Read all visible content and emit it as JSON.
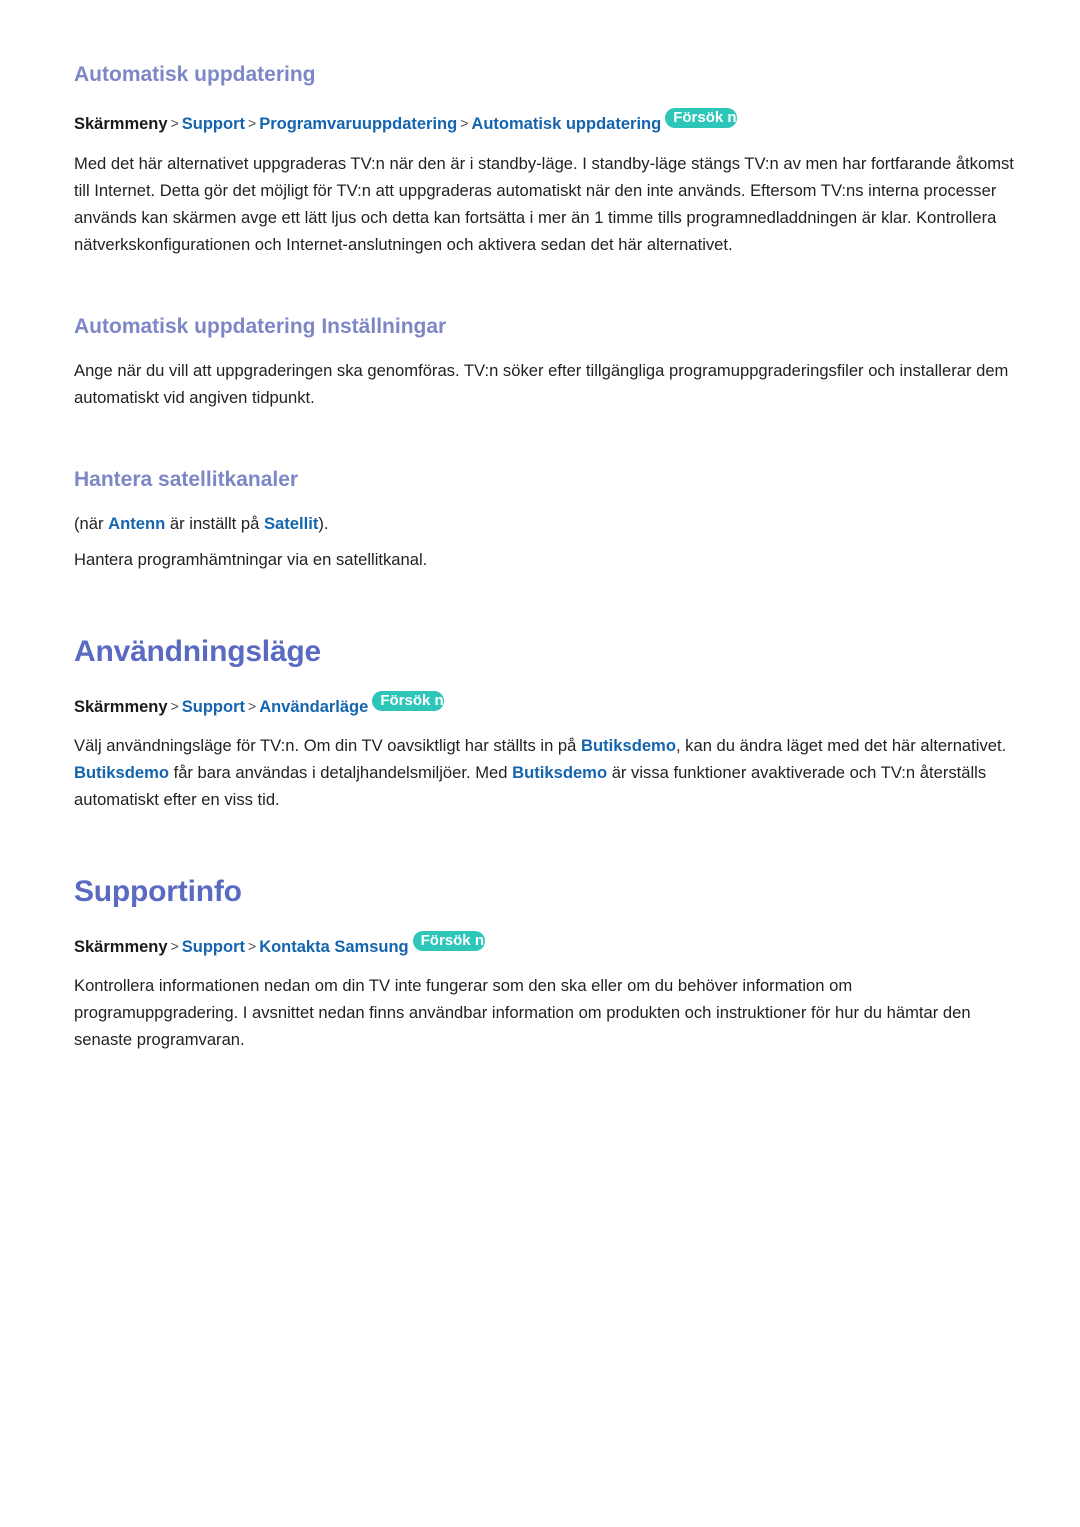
{
  "document": {
    "language": "sv",
    "colors": {
      "major_heading": "#5a6ac0",
      "sub_heading": "#7d87c6",
      "link": "#1464ae",
      "badge_background": "#2dc6b9",
      "badge_text": "#ffffff",
      "body_text": "#231f20",
      "page_background": "#ffffff"
    }
  },
  "sections": {
    "auto_update": {
      "heading": "Automatisk uppdatering",
      "breadcrumb": {
        "root": "Skärmmeny",
        "separator": ">",
        "links": [
          "Support",
          "Programvaruuppdatering",
          "Automatisk uppdatering"
        ],
        "badge": "Försök nu"
      },
      "paragraph": "Med det här alternativet uppgraderas TV:n när den är i standby-läge. I standby-läge stängs TV:n av men har fortfarande åtkomst till Internet. Detta gör det möjligt för TV:n att uppgraderas automatiskt när den inte används. Eftersom TV:ns interna processer används kan skärmen avge ett lätt ljus och detta kan fortsätta i mer än 1 timme tills programnedladdningen är klar. Kontrollera nätverkskonfigurationen och Internet-anslutningen och aktivera sedan det här alternativet."
    },
    "auto_update_settings": {
      "heading": "Automatisk uppdatering Inställningar",
      "paragraph": "Ange när du vill att uppgraderingen ska genomföras. TV:n söker efter tillgängliga programuppgraderingsfiler och installerar dem automatiskt vid angiven tidpunkt."
    },
    "manage_satellite": {
      "heading": "Hantera satellitkanaler",
      "condition": {
        "prefix": "(när ",
        "link_1": "Antenn",
        "middle": " är inställt på ",
        "link_2": "Satellit",
        "suffix": ")."
      },
      "paragraph": "Hantera programhämtningar via en satellitkanal."
    },
    "usage_mode": {
      "heading": "Användningsläge",
      "breadcrumb": {
        "root": "Skärmmeny",
        "separator": ">",
        "links": [
          "Support",
          "Användarläge"
        ],
        "badge": "Försök nu"
      },
      "paragraph": {
        "part_1": "Välj användningsläge för TV:n. Om din TV oavsiktligt har ställts in på ",
        "hl_1": "Butiksdemo",
        "part_2": ", kan du ändra läget med det här alternativet. ",
        "hl_2": "Butiksdemo",
        "part_3": " får bara användas i detaljhandelsmiljöer. Med ",
        "hl_3": "Butiksdemo",
        "part_4": " är vissa funktioner avaktiverade och TV:n återställs automatiskt efter en viss tid."
      }
    },
    "support_info": {
      "heading": "Supportinfo",
      "breadcrumb": {
        "root": "Skärmmeny",
        "separator": ">",
        "links": [
          "Support",
          "Kontakta Samsung"
        ],
        "badge": "Försök nu"
      },
      "paragraph": "Kontrollera informationen nedan om din TV inte fungerar som den ska eller om du behöver information om programuppgradering. I avsnittet nedan finns användbar information om produkten och instruktioner för hur du hämtar den senaste programvaran."
    }
  }
}
